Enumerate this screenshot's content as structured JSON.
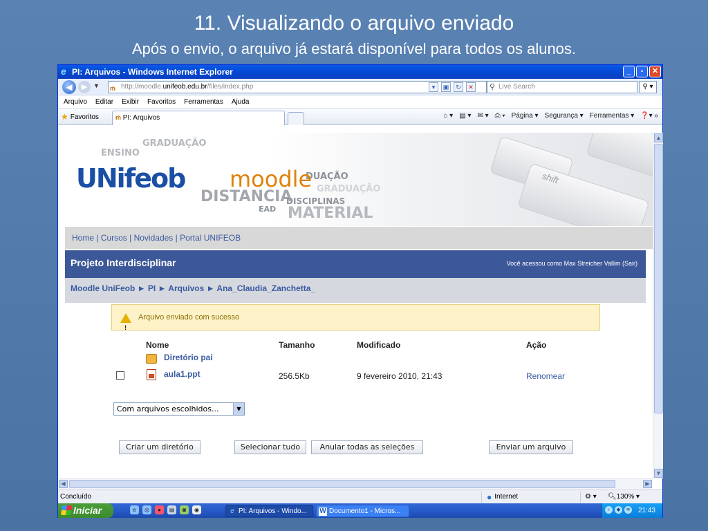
{
  "slide": {
    "title": "11. Visualizando o arquivo enviado",
    "subtitle": "Após o envio, o arquivo já estará disponível para todos os alunos."
  },
  "browser": {
    "window_title": "PI: Arquivos - Windows Internet Explorer",
    "url_prefix": "http://moodle.",
    "url_domain": "unifeob.edu.br",
    "url_path": "/files/index.php",
    "search_placeholder": "Live Search",
    "menu": [
      "Arquivo",
      "Editar",
      "Exibir",
      "Favoritos",
      "Ferramentas",
      "Ajuda"
    ],
    "favorites_label": "Favoritos",
    "tab_label": "PI: Arquivos",
    "command_bar": [
      "Página ▾",
      "Segurança ▾",
      "Ferramentas ▾"
    ],
    "status_text": "Concluído",
    "zone": "Internet",
    "zoom": "130%"
  },
  "taskbar": {
    "start_label": "Iniciar",
    "tasks": [
      "PI: Arquivos - Windo...",
      "Documento1 - Micros..."
    ],
    "clock": "21:43"
  },
  "page": {
    "banner_words": {
      "ensino": "ENSINO",
      "graduacao1": "GRADUAÇÃO",
      "duacao": "DUAÇÃO",
      "graduacao2": "GRADUAÇÃO",
      "distancia": "DISTANCIA",
      "disciplinas": "DISCIPLINAS",
      "material": "MATERIAL",
      "ead": "EAD",
      "shift": "shift"
    },
    "logo_main": "UNifeob",
    "logo_moodle": "moodle",
    "top_nav": "Home | Cursos | Novidades | Portal UNIFEOB",
    "course_title": "Projeto Interdisciplinar",
    "login_info": "Você acessou como Max Streicher Vallim (Sair)",
    "navbar": "Moodle UniFeob ► PI ► Arquivos ► Ana_Claudia_Zanchetta_",
    "notice": "Arquivo enviado com sucesso",
    "table": {
      "headers": [
        "Nome",
        "Tamanho",
        "Modificado",
        "Ação"
      ],
      "parent_dir": "Diretório pai",
      "rows": [
        {
          "name": "aula1.ppt",
          "size": "256.5Kb",
          "modified": "9 fevereiro 2010, 21:43",
          "action": "Renomear"
        }
      ]
    },
    "with_selected": "Com arquivos escolhidos...",
    "buttons": {
      "create_dir": "Criar um diretório",
      "select_all": "Selecionar tudo",
      "deselect_all": "Anular todas as seleções",
      "upload": "Enviar um arquivo"
    }
  },
  "colors": {
    "slide_bg": "#4f77a8",
    "course_header": "#3c5898",
    "link": "#3a5ba0",
    "logo_blue": "#1a4fa5",
    "logo_orange": "#e0820a"
  }
}
